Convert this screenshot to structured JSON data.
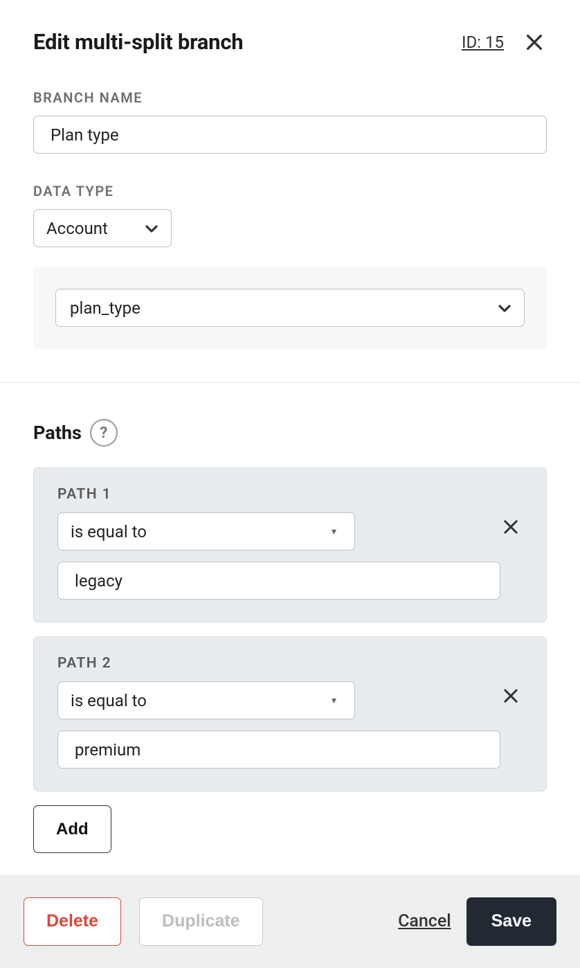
{
  "header": {
    "title": "Edit multi-split branch",
    "id_label": "ID: 15"
  },
  "form": {
    "branch_name_label": "BRANCH NAME",
    "branch_name_value": "Plan type",
    "data_type_label": "DATA TYPE",
    "data_type_value": "Account",
    "field_value": "plan_type"
  },
  "paths_section": {
    "title": "Paths",
    "help_glyph": "?",
    "paths": [
      {
        "label": "PATH 1",
        "operator": "is equal to",
        "value": "legacy"
      },
      {
        "label": "PATH 2",
        "operator": "is equal to",
        "value": "premium"
      }
    ],
    "add_label": "Add"
  },
  "footer": {
    "delete_label": "Delete",
    "duplicate_label": "Duplicate",
    "cancel_label": "Cancel",
    "save_label": "Save"
  }
}
